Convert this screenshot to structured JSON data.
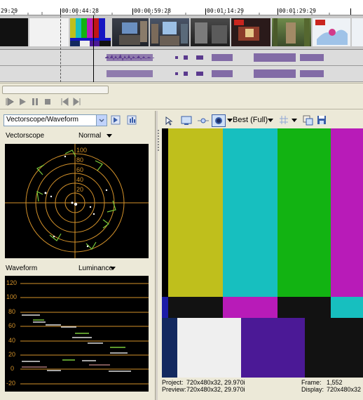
{
  "timeline": {
    "timecodes": [
      "29:29",
      "00:00:44:28",
      "00:00:59:28",
      "00:01:14:29",
      "00:01:29:29"
    ]
  },
  "transport": {
    "buttons": [
      "play-from-start",
      "play",
      "pause",
      "stop",
      "previous-frame",
      "next-frame"
    ]
  },
  "scopes": {
    "selector_value": "Vectorscope/Waveform",
    "vectorscope_label": "Vectorscope",
    "vectorscope_mode": "Normal",
    "vectorscope_scale": [
      "100",
      "80",
      "60",
      "40",
      "20"
    ],
    "waveform_label": "Waveform",
    "waveform_mode": "Luminance",
    "waveform_scale": [
      "120",
      "100",
      "80",
      "60",
      "40",
      "20",
      "0",
      "-20"
    ]
  },
  "preview": {
    "quality": "Best (Full)",
    "project_label": "Project:",
    "project_value": "720x480x32, 29.970i",
    "preview_label": "Preview:",
    "preview_value": "720x480x32, 29.970i",
    "frame_label": "Frame:",
    "frame_value": "1,552",
    "display_label": "Display:",
    "display_value": "720x480x32"
  },
  "colors": {
    "scope_graticule": "#d4922a",
    "scope_target": "#7acb3c",
    "bars": [
      "#bfbf1c",
      "#17bfbf",
      "#12b312",
      "#b81bb8"
    ],
    "accent": "#3a5ea8"
  }
}
